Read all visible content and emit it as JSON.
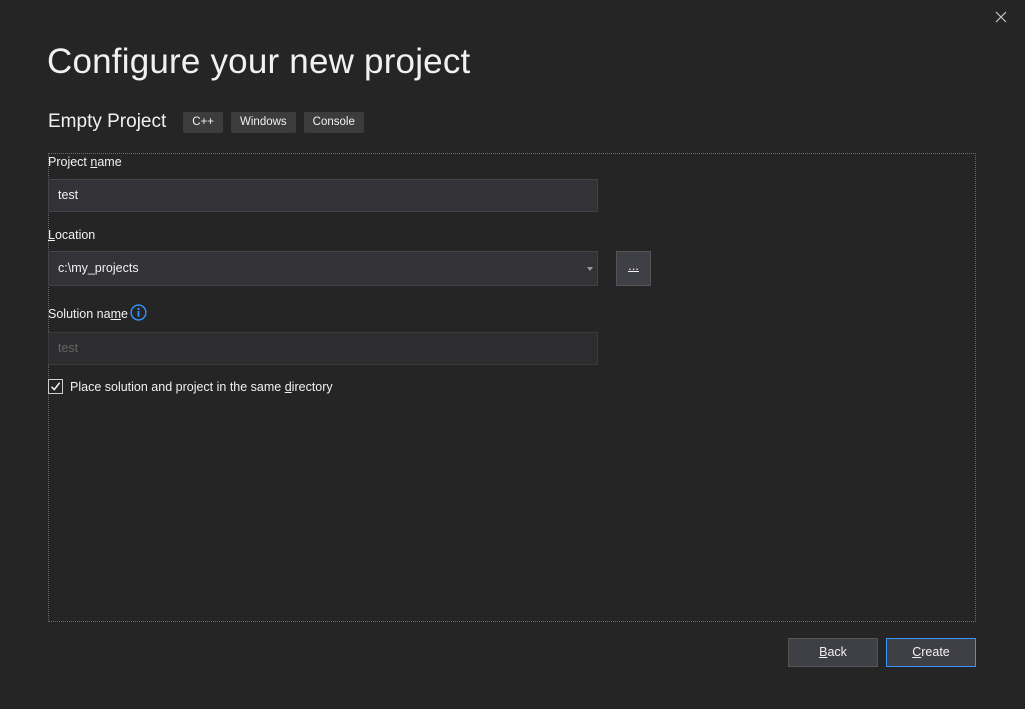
{
  "dialog": {
    "title": "Configure your new project",
    "close_icon": "close-icon"
  },
  "template": {
    "name": "Empty Project",
    "tags": [
      "C++",
      "Windows",
      "Console"
    ]
  },
  "form": {
    "project_name": {
      "label_pre": "Project ",
      "label_access": "n",
      "label_post": "ame",
      "value": "test"
    },
    "location": {
      "label_pre": "",
      "label_access": "L",
      "label_post": "ocation",
      "value": "c:\\my_projects",
      "browse_label": "..."
    },
    "solution_name": {
      "label_pre": "Solution na",
      "label_access": "m",
      "label_post": "e",
      "placeholder": "test",
      "info_icon": "info-icon"
    },
    "same_directory": {
      "checked": true,
      "label_pre": "Place solution and project in the same ",
      "label_access": "d",
      "label_post": "irectory"
    }
  },
  "footer": {
    "back": {
      "access": "B",
      "rest": "ack"
    },
    "create": {
      "access": "C",
      "rest": "reate"
    }
  },
  "colors": {
    "background": "#252526",
    "accent_border": "#3794ff",
    "info_icon": "#3794ff"
  }
}
